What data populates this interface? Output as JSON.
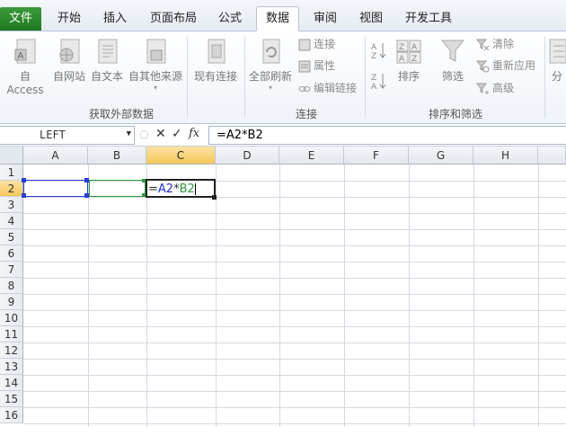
{
  "tabs": [
    "文件",
    "开始",
    "插入",
    "页面布局",
    "公式",
    "数据",
    "审阅",
    "视图",
    "开发工具"
  ],
  "active_tab": "数据",
  "ribbon": {
    "external": {
      "access": "自 Access",
      "web": "自网站",
      "text": "自文本",
      "other": "自其他来源",
      "existing": "现有连接",
      "group_label": "获取外部数据"
    },
    "connections": {
      "refresh_all": "全部刷新",
      "connections": "连接",
      "properties": "属性",
      "edit_links": "编辑链接",
      "group_label": "连接"
    },
    "sort_filter": {
      "sort": "排序",
      "filter": "筛选",
      "clear": "清除",
      "reapply": "重新应用",
      "advanced": "高级",
      "group_label": "排序和筛选"
    },
    "partial": "分"
  },
  "formula_bar": {
    "name_box": "LEFT",
    "cancel": "✕",
    "enter": "✓",
    "fx": "fx",
    "formula": "=A2*B2"
  },
  "columns": [
    "A",
    "B",
    "C",
    "D",
    "E",
    "F",
    "G",
    "H"
  ],
  "rows": [
    "1",
    "2",
    "3",
    "4",
    "5",
    "6",
    "7",
    "8",
    "9",
    "10",
    "11",
    "12",
    "13",
    "14",
    "15",
    "16"
  ],
  "cell_c2": {
    "prefix": "=",
    "ref1": "A2",
    "op": "*",
    "ref2": "B2"
  },
  "colors": {
    "ref_a": "#2b3bd6",
    "ref_b": "#2f9a3a",
    "file_tab": "#2a8a2a",
    "selected_header": "#f6c65b"
  }
}
